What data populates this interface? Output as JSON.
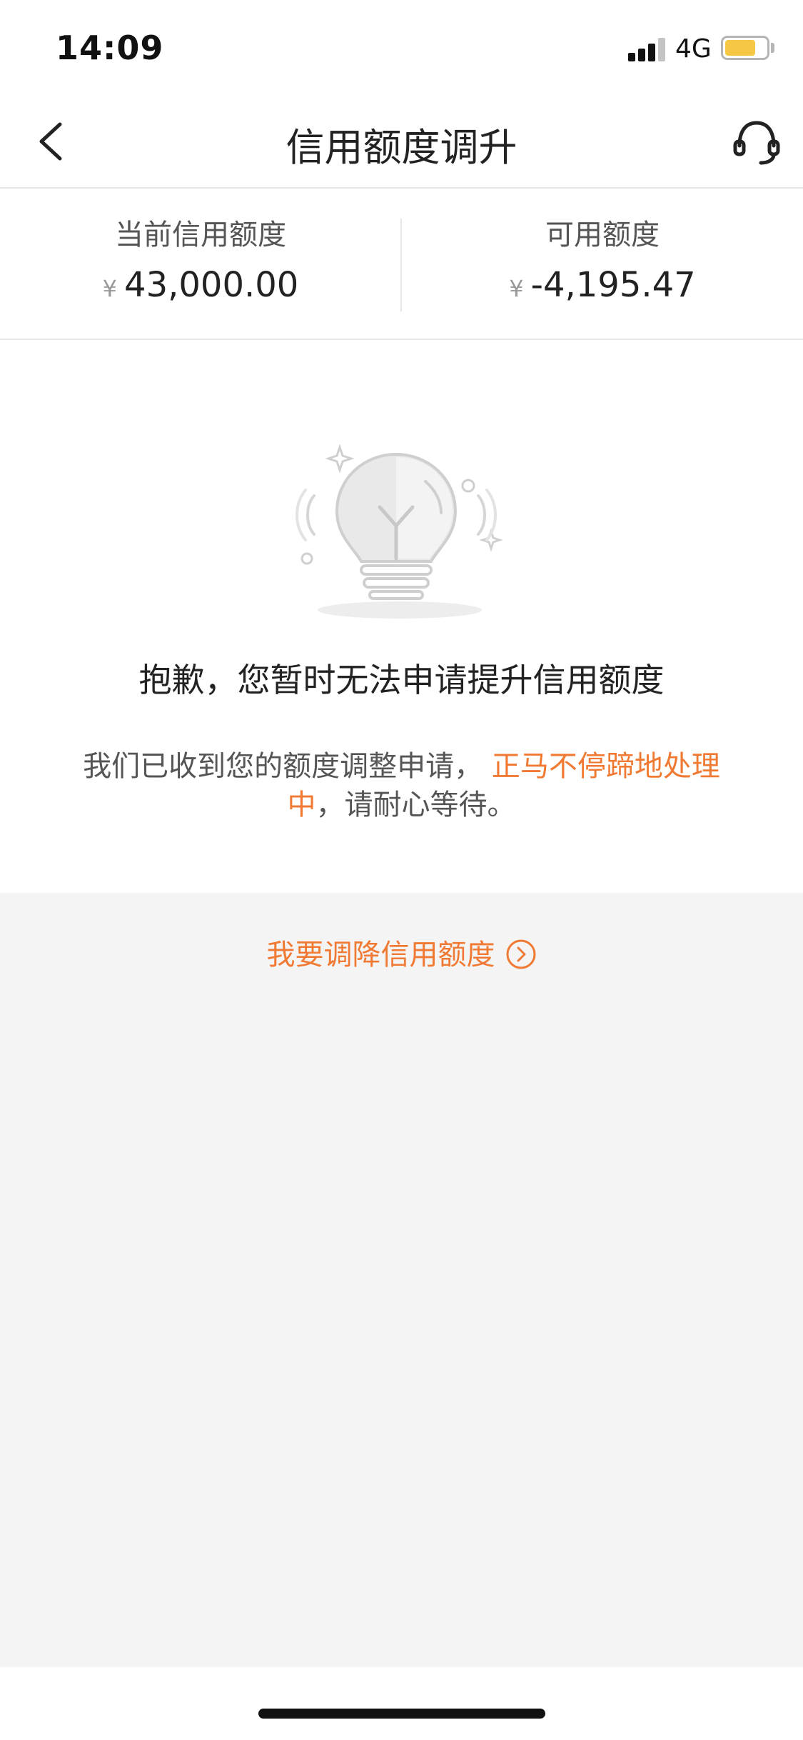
{
  "status_bar": {
    "time": "14:09",
    "network": "4G",
    "battery_level": 0.75,
    "battery_color": "#f6c744"
  },
  "nav": {
    "title": "信用额度调升",
    "back_icon": "chevron-left-icon",
    "service_icon": "headset-icon"
  },
  "summary": {
    "current_limit_label": "当前信用额度",
    "current_limit_currency": "¥",
    "current_limit_value": "43,000.00",
    "available_label": "可用额度",
    "available_currency": "¥",
    "available_value": "-4,195.47"
  },
  "message": {
    "illustration_icon": "lightbulb-icon",
    "title": "抱歉，您暂时无法申请提升信用额度",
    "body_prefix": "我们已收到您的额度调整申请， ",
    "body_highlight": "正马不停蹄地处理中",
    "body_suffix": "，请耐心等待。"
  },
  "action": {
    "label": "我要调降信用额度",
    "icon": "chevron-right-circle-icon"
  },
  "colors": {
    "accent": "#f07a33",
    "background": "#f4f4f4"
  }
}
